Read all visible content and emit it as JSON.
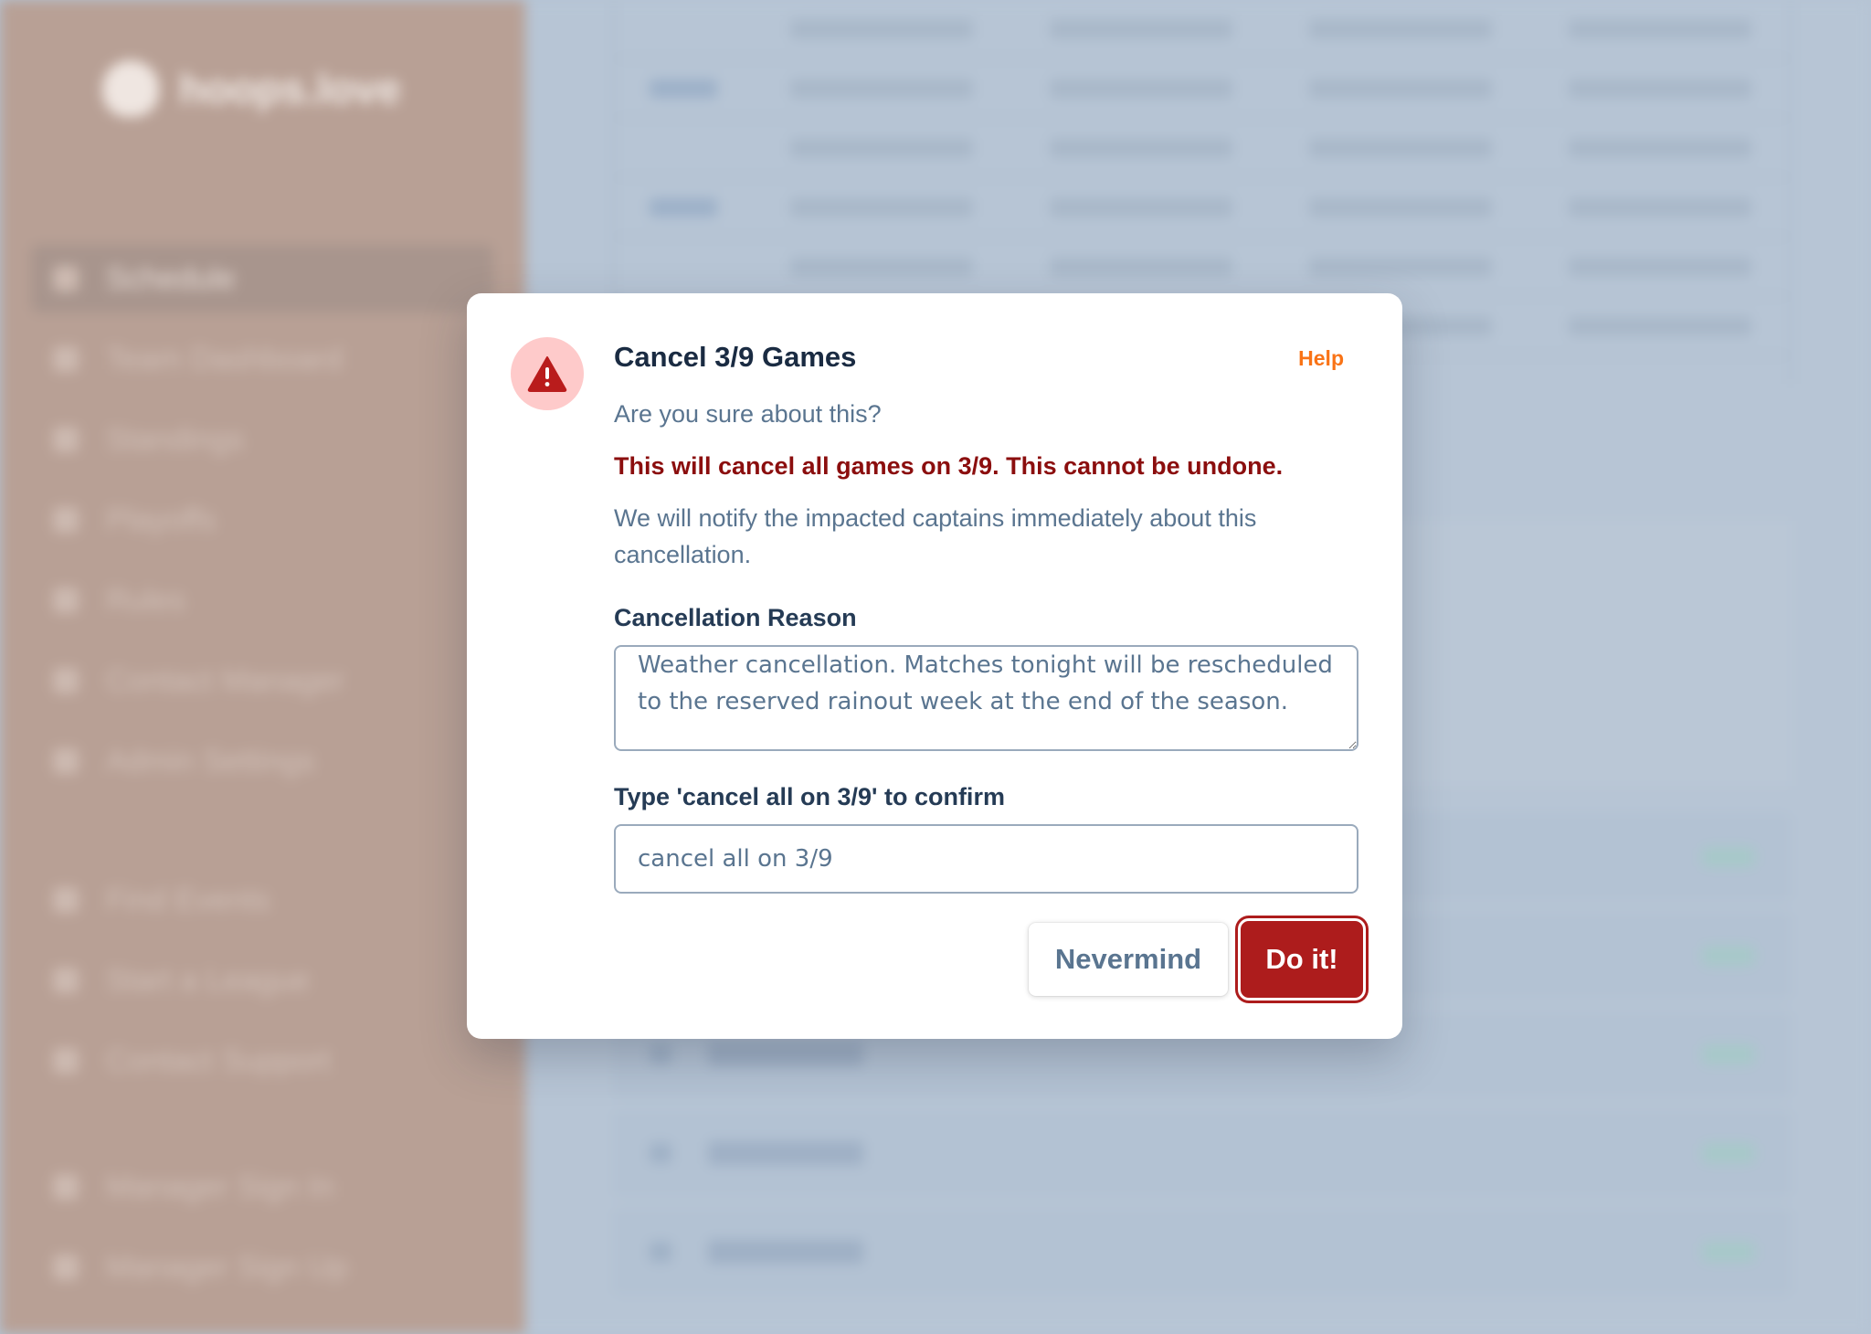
{
  "background": {
    "app_name": "hoops.love",
    "nav_items": [
      {
        "label": "Schedule",
        "icon": "calendar-icon",
        "active": true
      },
      {
        "label": "Team Dashboard",
        "icon": "team-icon"
      },
      {
        "label": "Standings",
        "icon": "chart-icon"
      },
      {
        "label": "Playoffs",
        "icon": "trophy-icon"
      },
      {
        "label": "Rules",
        "icon": "book-icon"
      },
      {
        "label": "Contact Manager",
        "icon": "mail-icon"
      },
      {
        "label": "Admin Settings",
        "icon": "shield-icon"
      }
    ],
    "nav_items_secondary": [
      {
        "label": "Find Events",
        "icon": "search-icon"
      },
      {
        "label": "Start a League",
        "icon": "plus-icon"
      },
      {
        "label": "Contact Support",
        "icon": "help-icon"
      }
    ],
    "nav_items_auth": [
      {
        "label": "Manager Sign In",
        "icon": "login-icon"
      },
      {
        "label": "Manager Sign Up",
        "icon": "user-plus-icon"
      }
    ]
  },
  "modal": {
    "title": "Cancel 3/9 Games",
    "help_label": "Help",
    "subtitle": "Are you sure about this?",
    "warning": "This will cancel all games on 3/9. This cannot be undone.",
    "notice": "We will notify the impacted captains immediately about this cancellation.",
    "reason_label": "Cancellation Reason",
    "reason_value": "Weather cancellation. Matches tonight will be rescheduled to the reserved rainout week at the end of the season.",
    "confirm_label": "Type 'cancel all on 3/9' to confirm",
    "confirm_value": "cancel all on 3/9",
    "cancel_button": "Nevermind",
    "confirm_button": "Do it!",
    "colors": {
      "danger": "#ad1c1c",
      "danger_text": "#8b0e0e",
      "help": "#f97316",
      "warning_bg": "#fecaca"
    }
  }
}
